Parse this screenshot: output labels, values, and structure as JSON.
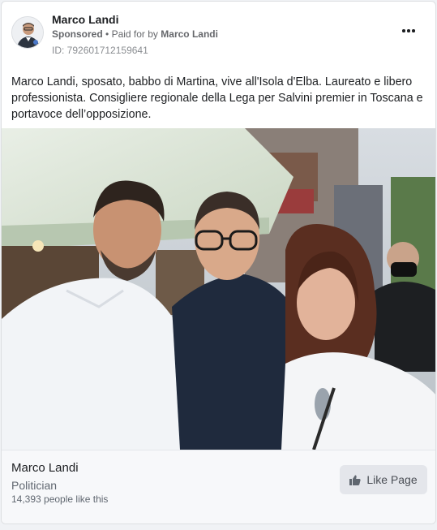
{
  "header": {
    "page_name": "Marco Landi",
    "sponsored_label": "Sponsored",
    "separator": "•",
    "paid_for_prefix": "Paid for by",
    "paid_for_by": "Marco Landi",
    "ad_id": "ID: 792601712159641",
    "more_icon": "more-options-icon"
  },
  "post": {
    "text": "Marco Landi, sposato, babbo di Martina, vive all'Isola d'Elba. Laureato e libero professionista. Consigliere regionale della Lega per Salvini premier in Toscana e portavoce dell’opposizione."
  },
  "footer": {
    "page_name": "Marco Landi",
    "category": "Politician",
    "likes": "14,393 people like this",
    "like_button_label": "Like Page",
    "like_icon": "thumbs-up-icon"
  },
  "colors": {
    "card_bg": "#ffffff",
    "footer_bg": "#f7f8fa",
    "button_bg": "#e4e6eb",
    "text": "#1c1e21",
    "muted": "#65676b"
  }
}
